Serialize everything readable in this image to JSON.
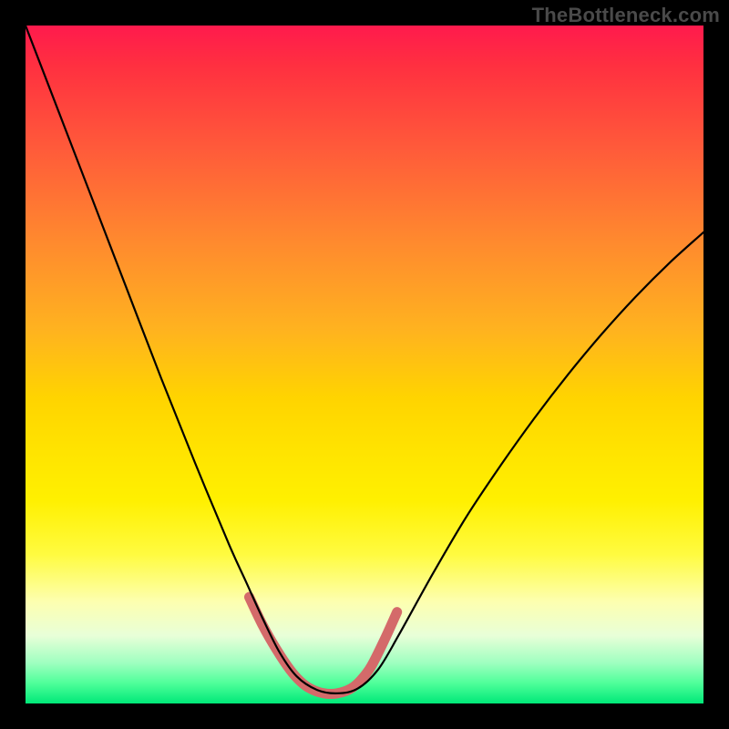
{
  "watermark": "TheBottleneck.com",
  "chart_data": {
    "type": "line",
    "title": "",
    "xlabel": "",
    "ylabel": "",
    "xlim": [
      0,
      1
    ],
    "ylim": [
      0,
      1
    ],
    "series": [
      {
        "name": "main-curve",
        "color": "#000000",
        "width": 2.2,
        "x": [
          0.0,
          0.05,
          0.1,
          0.15,
          0.2,
          0.25,
          0.3,
          0.325,
          0.35,
          0.375,
          0.4,
          0.43,
          0.46,
          0.49,
          0.52,
          0.55,
          0.6,
          0.65,
          0.7,
          0.75,
          0.8,
          0.85,
          0.9,
          0.95,
          1.0
        ],
        "y": [
          1.0,
          0.87,
          0.74,
          0.61,
          0.48,
          0.355,
          0.235,
          0.18,
          0.125,
          0.075,
          0.04,
          0.02,
          0.015,
          0.022,
          0.05,
          0.1,
          0.19,
          0.275,
          0.35,
          0.42,
          0.485,
          0.545,
          0.6,
          0.65,
          0.695
        ]
      },
      {
        "name": "highlight-trough",
        "color": "#d46a6a",
        "width": 11,
        "x": [
          0.33,
          0.35,
          0.37,
          0.39,
          0.405,
          0.42,
          0.44,
          0.46,
          0.48,
          0.495,
          0.51,
          0.53,
          0.548
        ],
        "y": [
          0.157,
          0.115,
          0.08,
          0.05,
          0.033,
          0.022,
          0.015,
          0.015,
          0.022,
          0.035,
          0.055,
          0.095,
          0.135
        ]
      }
    ]
  }
}
